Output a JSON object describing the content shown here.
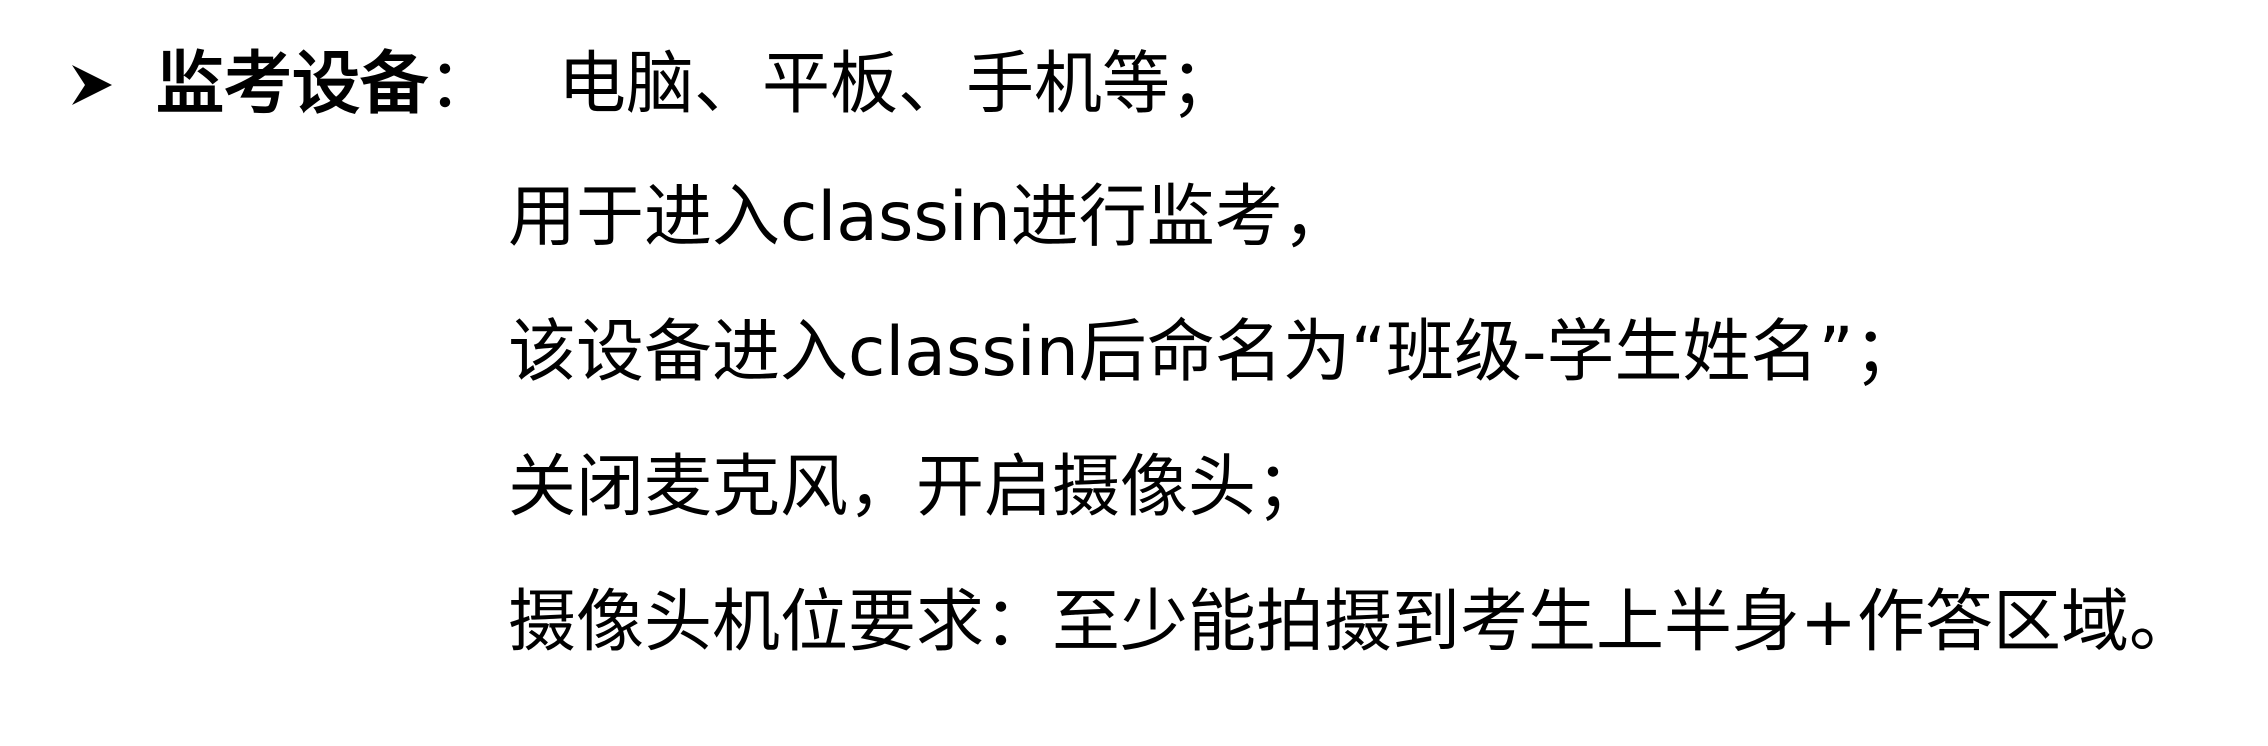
{
  "bullet": {
    "icon": "right-arrowhead-icon",
    "heading": "监考设备",
    "separator": "：",
    "first_line": "电脑、平板、手机等；"
  },
  "details": [
    "用于进入classin进行监考，",
    "该设备进入classin后命名为“班级-学生姓名”；",
    "关闭麦克风，开启摄像头；",
    "摄像头机位要求：至少能拍摄到考生上半身+作答区域。"
  ],
  "colors": {
    "text": "#000000",
    "background": "#ffffff"
  }
}
